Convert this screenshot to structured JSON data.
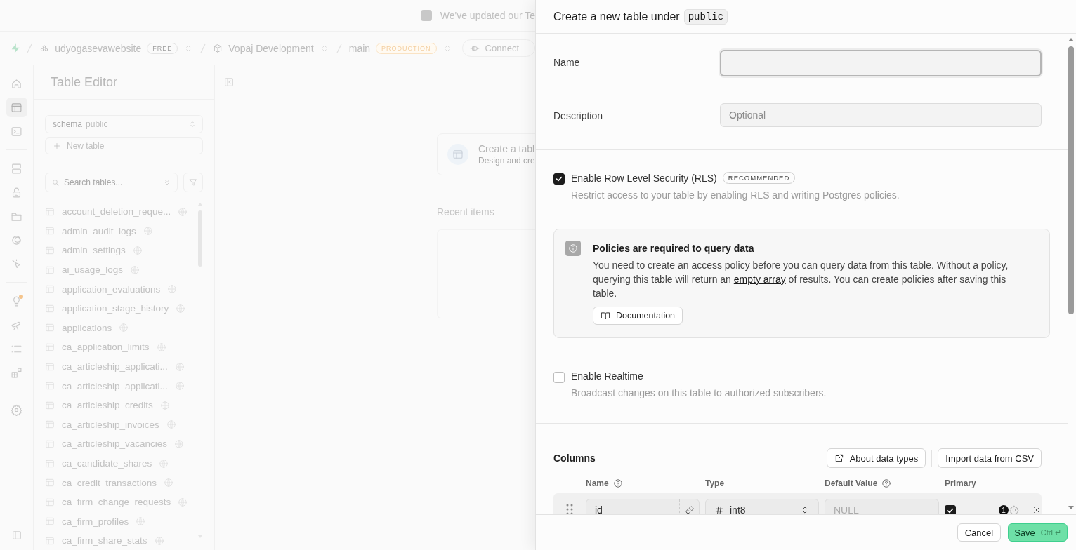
{
  "banner": {
    "text": "We've updated our Te"
  },
  "nav": {
    "org": {
      "name": "udyogasevawebsite",
      "badge": "FREE"
    },
    "project": {
      "name": "Vopaj Development"
    },
    "branch": {
      "name": "main",
      "badge": "PRODUCTION"
    },
    "connect": "Connect"
  },
  "rail": {
    "groups": [
      [
        {
          "kind": "home",
          "selected": false,
          "dot": false
        },
        {
          "kind": "table",
          "selected": true,
          "dot": false
        },
        {
          "kind": "terminal",
          "selected": false,
          "dot": false
        }
      ],
      [
        {
          "kind": "database",
          "selected": false,
          "dot": false
        },
        {
          "kind": "lock",
          "selected": false,
          "dot": false
        },
        {
          "kind": "folder",
          "selected": false,
          "dot": false
        },
        {
          "kind": "ring",
          "selected": false,
          "dot": false
        },
        {
          "kind": "pointer",
          "selected": false,
          "dot": false
        }
      ],
      [
        {
          "kind": "bulb",
          "selected": false,
          "dot": true
        },
        {
          "kind": "telescope",
          "selected": false,
          "dot": false
        },
        {
          "kind": "list",
          "selected": false,
          "dot": false
        },
        {
          "kind": "blocks",
          "selected": false,
          "dot": false
        }
      ],
      [
        {
          "kind": "gear",
          "selected": false,
          "dot": false
        }
      ]
    ]
  },
  "sidebar": {
    "title": "Table Editor",
    "schema": {
      "label": "schema",
      "value": "public"
    },
    "new_table": "New table",
    "search": {
      "placeholder": "Search tables..."
    },
    "tables": [
      "account_deletion_reque...",
      "admin_audit_logs",
      "admin_settings",
      "ai_usage_logs",
      "application_evaluations",
      "application_stage_history",
      "applications",
      "ca_application_limits",
      "ca_articleship_applicati...",
      "ca_articleship_applicati...",
      "ca_articleship_credits",
      "ca_articleship_invoices",
      "ca_articleship_vacancies",
      "ca_candidate_shares",
      "ca_credit_transactions",
      "ca_firm_change_requests",
      "ca_firm_profiles",
      "ca_firm_share_stats"
    ]
  },
  "main": {
    "card": {
      "title": "Create a tabl",
      "subtitle": "Design and cre"
    },
    "recent": "Recent items"
  },
  "drawer": {
    "title": "Create a new table under",
    "schema": "public",
    "name_field": {
      "label": "Name",
      "focused": true
    },
    "description_field": {
      "label": "Description",
      "placeholder": "Optional"
    },
    "rls": {
      "label": "Enable Row Level Security (RLS)",
      "badge": "RECOMMENDED",
      "description": "Restrict access to your table by enabling RLS and writing Postgres policies.",
      "checked": true
    },
    "notice": {
      "title": "Policies are required to query data",
      "body_before": "You need to create an access policy before you can query data from this table. Without a policy, querying this table will return an",
      "link": "empty array",
      "body_after": "of results. You can create policies after saving this table.",
      "button": "Documentation"
    },
    "realtime": {
      "label": "Enable Realtime",
      "description": "Broadcast changes on this table to authorized subscribers.",
      "checked": false
    },
    "columns": {
      "heading": "Columns",
      "buttons": [
        {
          "label": "About data types",
          "icon": true
        },
        {
          "label": "Import data from CSV",
          "icon": false
        }
      ],
      "headers": [
        {
          "label": "Name",
          "help": true
        },
        {
          "label": "Type",
          "help": false
        },
        {
          "label": "Default Value",
          "help": true
        },
        {
          "label": "Primary",
          "help": false
        }
      ],
      "rows": [
        {
          "name": "id",
          "type": "int8",
          "default_placeholder": "NULL",
          "primary": true,
          "count": "1"
        }
      ]
    },
    "footer": {
      "cancel": "Cancel",
      "save": "Save",
      "shortcut": "Ctrl ↵"
    }
  }
}
